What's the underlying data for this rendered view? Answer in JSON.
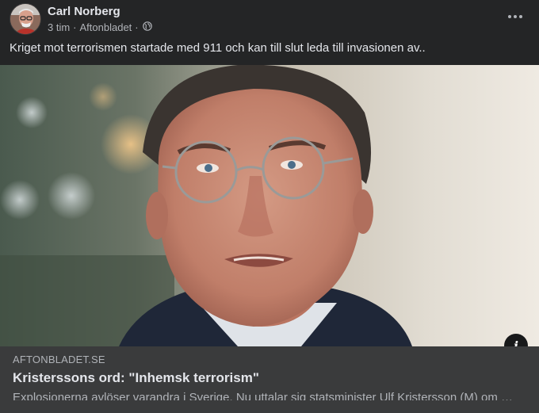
{
  "post": {
    "author": "Carl Norberg",
    "time": "3 tim",
    "separator": "·",
    "source": "Aftonbladet",
    "audience_icon": "globe-icon",
    "more_icon": "more-options-icon",
    "text": "Kriget mot terrorismen startade med 911 och kan till slut leda till invasionen av.."
  },
  "link": {
    "domain": "AFTONBLADET.SE",
    "headline": "Kristerssons ord: \"Inhemsk terrorism\"",
    "description": "Explosionerna avlöser varandra i Sverige. Nu uttalar sig statsminister Ulf Kristersson (M) om …",
    "info_icon": "i"
  },
  "colors": {
    "background": "#242526",
    "link_info_bg": "#3a3b3c",
    "primary_text": "#e4e6eb",
    "secondary_text": "#b0b3b8"
  }
}
